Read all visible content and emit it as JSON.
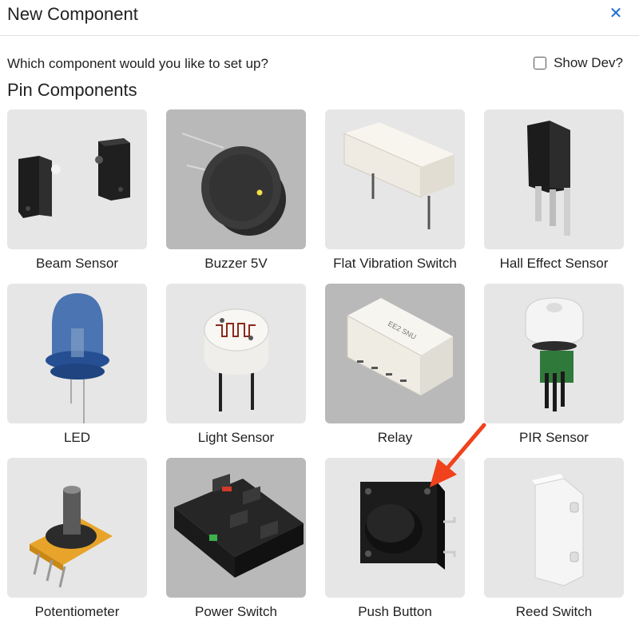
{
  "dialog": {
    "title": "New Component",
    "close_icon": "close-icon",
    "question": "Which component would you like to set up?",
    "show_dev_label": "Show Dev?",
    "show_dev_checked": false,
    "section_title": "Pin Components"
  },
  "components": [
    {
      "label": "Beam Sensor",
      "icon": "beam-sensor-icon"
    },
    {
      "label": "Buzzer 5V",
      "icon": "buzzer-icon"
    },
    {
      "label": "Flat Vibration Switch",
      "icon": "vibration-switch-icon"
    },
    {
      "label": "Hall Effect Sensor",
      "icon": "hall-effect-sensor-icon"
    },
    {
      "label": "LED",
      "icon": "led-icon"
    },
    {
      "label": "Light Sensor",
      "icon": "light-sensor-icon"
    },
    {
      "label": "Relay",
      "icon": "relay-icon"
    },
    {
      "label": "PIR Sensor",
      "icon": "pir-sensor-icon"
    },
    {
      "label": "Potentiometer",
      "icon": "potentiometer-icon"
    },
    {
      "label": "Power Switch",
      "icon": "power-switch-icon"
    },
    {
      "label": "Push Button",
      "icon": "push-button-icon"
    },
    {
      "label": "Reed Switch",
      "icon": "reed-switch-icon"
    }
  ],
  "relay_marking": "EE2 SNU",
  "colors": {
    "accent": "#1a6fd1",
    "annotation_arrow": "#f0421c",
    "card_background": "#e6e6e6",
    "card_background_selected": "#b9b9b9"
  }
}
